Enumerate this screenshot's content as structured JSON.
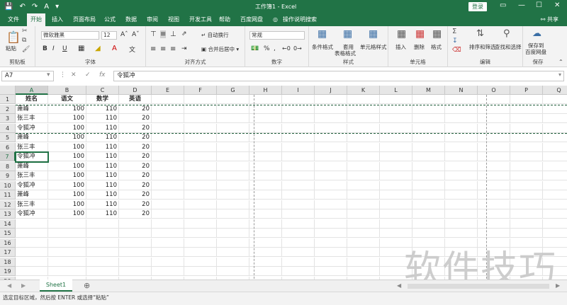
{
  "titlebar": {
    "qat": [
      "💾",
      "↶",
      "↷",
      "A",
      "▾"
    ],
    "title": "工作簿1 - Excel",
    "login": "登录",
    "controls": [
      "▭",
      "—",
      "☐",
      "✕"
    ]
  },
  "tabs": [
    {
      "label": "文件"
    },
    {
      "label": "开始"
    },
    {
      "label": "插入"
    },
    {
      "label": "页面布局"
    },
    {
      "label": "公式"
    },
    {
      "label": "数据"
    },
    {
      "label": "审阅"
    },
    {
      "label": "视图"
    },
    {
      "label": "开发工具"
    },
    {
      "label": "帮助"
    },
    {
      "label": "百度网盘"
    },
    {
      "label": "操作说明搜索"
    }
  ],
  "share": "共享",
  "ribbon": {
    "clipboard": {
      "paste": "粘贴",
      "label": "剪贴板"
    },
    "font": {
      "name": "微软雅黑",
      "size": "12",
      "label": "字体",
      "bold": "B",
      "italic": "I",
      "underline": "U"
    },
    "align": {
      "wrap": "自动换行",
      "merge": "合并后居中",
      "label": "对齐方式"
    },
    "number": {
      "format": "常规",
      "label": "数字"
    },
    "styles": {
      "cond": "条件格式",
      "table1": "套用",
      "table2": "表格格式",
      "cellstyle": "单元格样式",
      "label": "样式"
    },
    "cells": {
      "insert": "插入",
      "delete": "删除",
      "format": "格式",
      "label": "单元格"
    },
    "edit": {
      "sort": "排序和筛选",
      "find": "查找和选择",
      "label": "编辑"
    },
    "save": {
      "line1": "保存到",
      "line2": "百度网盘",
      "label": "保存"
    }
  },
  "formula": {
    "namebox": "A7",
    "content": "令狐冲"
  },
  "columns": [
    "A",
    "B",
    "C",
    "D",
    "E",
    "F",
    "G",
    "H",
    "I",
    "J",
    "K",
    "L",
    "M",
    "N",
    "O",
    "P",
    "Q"
  ],
  "rows": [
    "1",
    "2",
    "3",
    "4",
    "5",
    "6",
    "7",
    "8",
    "9",
    "10",
    "11",
    "12",
    "13",
    "14",
    "15",
    "16",
    "17",
    "18",
    "19",
    "20"
  ],
  "headers": [
    "姓名",
    "语文",
    "数学",
    "英语"
  ],
  "data": [
    [
      "萧峰",
      "100",
      "110",
      "20"
    ],
    [
      "张三丰",
      "100",
      "110",
      "20"
    ],
    [
      "令狐冲",
      "100",
      "110",
      "20"
    ],
    [
      "萧峰",
      "100",
      "110",
      "20"
    ],
    [
      "张三丰",
      "100",
      "110",
      "20"
    ],
    [
      "令狐冲",
      "100",
      "110",
      "20"
    ],
    [
      "萧峰",
      "100",
      "110",
      "20"
    ],
    [
      "张三丰",
      "100",
      "110",
      "20"
    ],
    [
      "令狐冲",
      "100",
      "110",
      "20"
    ],
    [
      "萧峰",
      "100",
      "110",
      "20"
    ],
    [
      "张三丰",
      "100",
      "110",
      "20"
    ],
    [
      "令狐冲",
      "100",
      "110",
      "20"
    ]
  ],
  "sheet": {
    "name": "Sheet1",
    "add": "⊕"
  },
  "status": "选定目标区域，然后按 ENTER 或选择“粘贴”",
  "watermark": "软件技巧",
  "colors": {
    "accent": "#217346"
  }
}
